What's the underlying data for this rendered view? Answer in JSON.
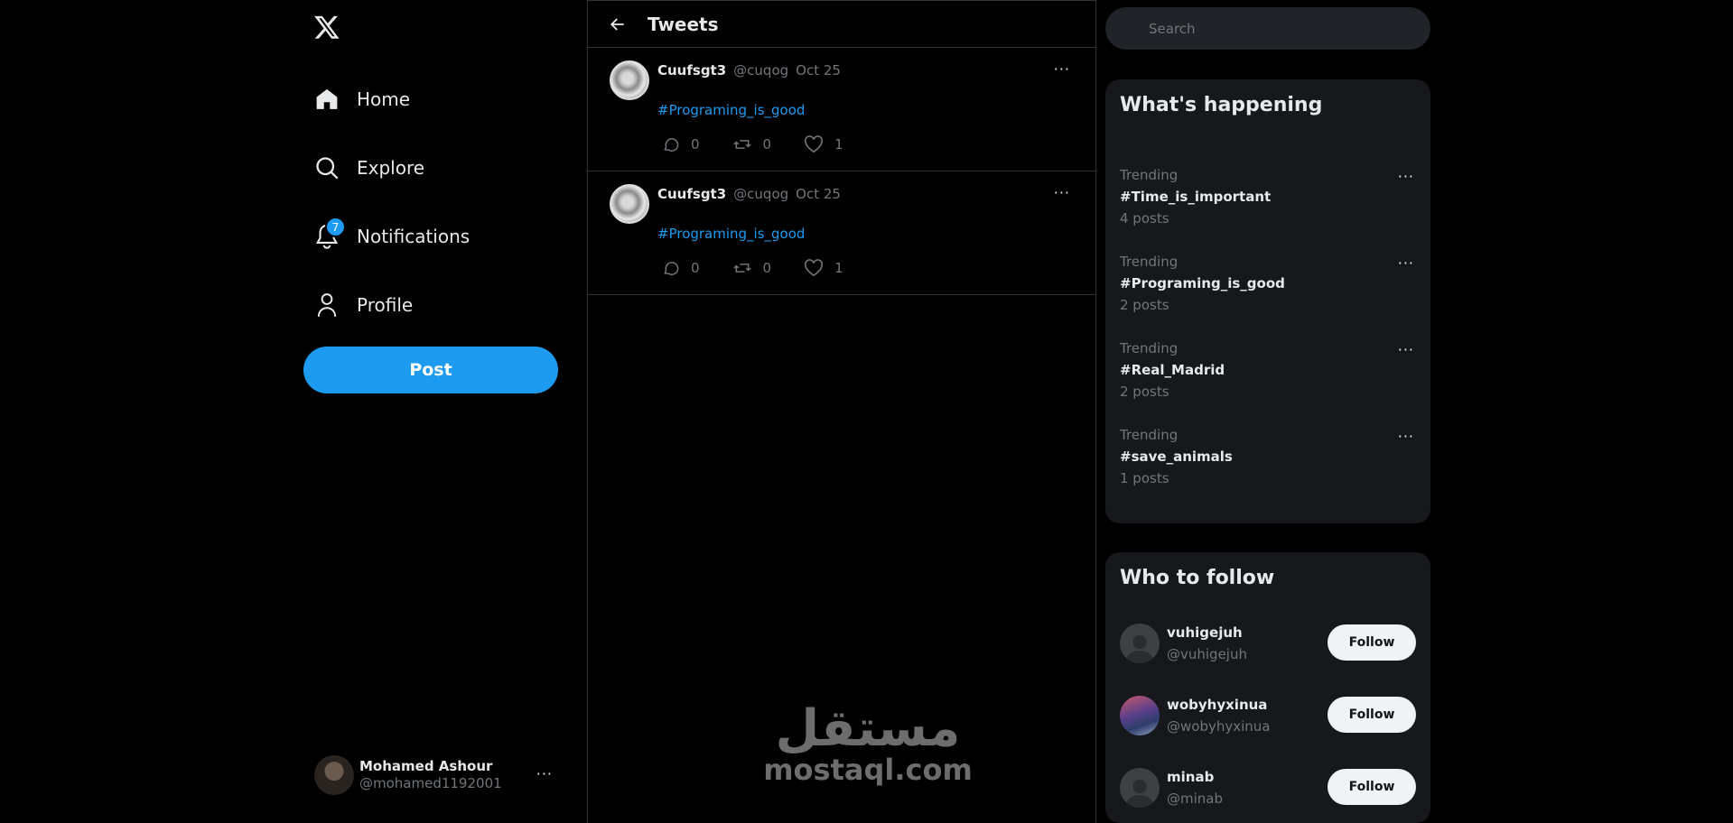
{
  "sidebar": {
    "logo_icon": "x-logo-icon",
    "nav": [
      {
        "label": "Home",
        "icon": "home-icon"
      },
      {
        "label": "Explore",
        "icon": "search-icon"
      },
      {
        "label": "Notifications",
        "icon": "bell-icon",
        "badge": "7"
      },
      {
        "label": "Profile",
        "icon": "person-icon"
      }
    ],
    "post_label": "Post",
    "account": {
      "name": "Mohamed Ashour",
      "handle": "@mohamed1192001",
      "more": "···"
    }
  },
  "main": {
    "title": "Tweets",
    "tweets": [
      {
        "name": "Cuufsgt3",
        "handle": "@cuqog",
        "date": "Oct 25",
        "hashtag": "#Programing_is_good",
        "replies": "0",
        "retweets": "0",
        "likes": "1",
        "more": "···"
      },
      {
        "name": "Cuufsgt3",
        "handle": "@cuqog",
        "date": "Oct 25",
        "hashtag": "#Programing_is_good",
        "replies": "0",
        "retweets": "0",
        "likes": "1",
        "more": "···"
      }
    ],
    "watermark": {
      "arabic": "مستقل",
      "latin": "mostaql.com"
    }
  },
  "right": {
    "search_placeholder": "Search",
    "trends_title": "What's happening",
    "trends": [
      {
        "category": "Trending",
        "name": "#Time_is_important",
        "count": "4 posts",
        "more": "···"
      },
      {
        "category": "Trending",
        "name": "#Programing_is_good",
        "count": "2 posts",
        "more": "···"
      },
      {
        "category": "Trending",
        "name": "#Real_Madrid",
        "count": "2 posts",
        "more": "···"
      },
      {
        "category": "Trending",
        "name": "#save_animals",
        "count": "1 posts",
        "more": "···"
      }
    ],
    "follow_title": "Who to follow",
    "follow": [
      {
        "name": "vuhigejuh",
        "handle": "@vuhigejuh",
        "button": "Follow"
      },
      {
        "name": "wobyhyxinua",
        "handle": "@wobyhyxinua",
        "button": "Follow"
      },
      {
        "name": "minab",
        "handle": "@minab",
        "button": "Follow"
      }
    ]
  },
  "colors": {
    "accent": "#1d9bf0",
    "background": "#000000",
    "panel": "#16181c",
    "muted": "#71767b"
  }
}
